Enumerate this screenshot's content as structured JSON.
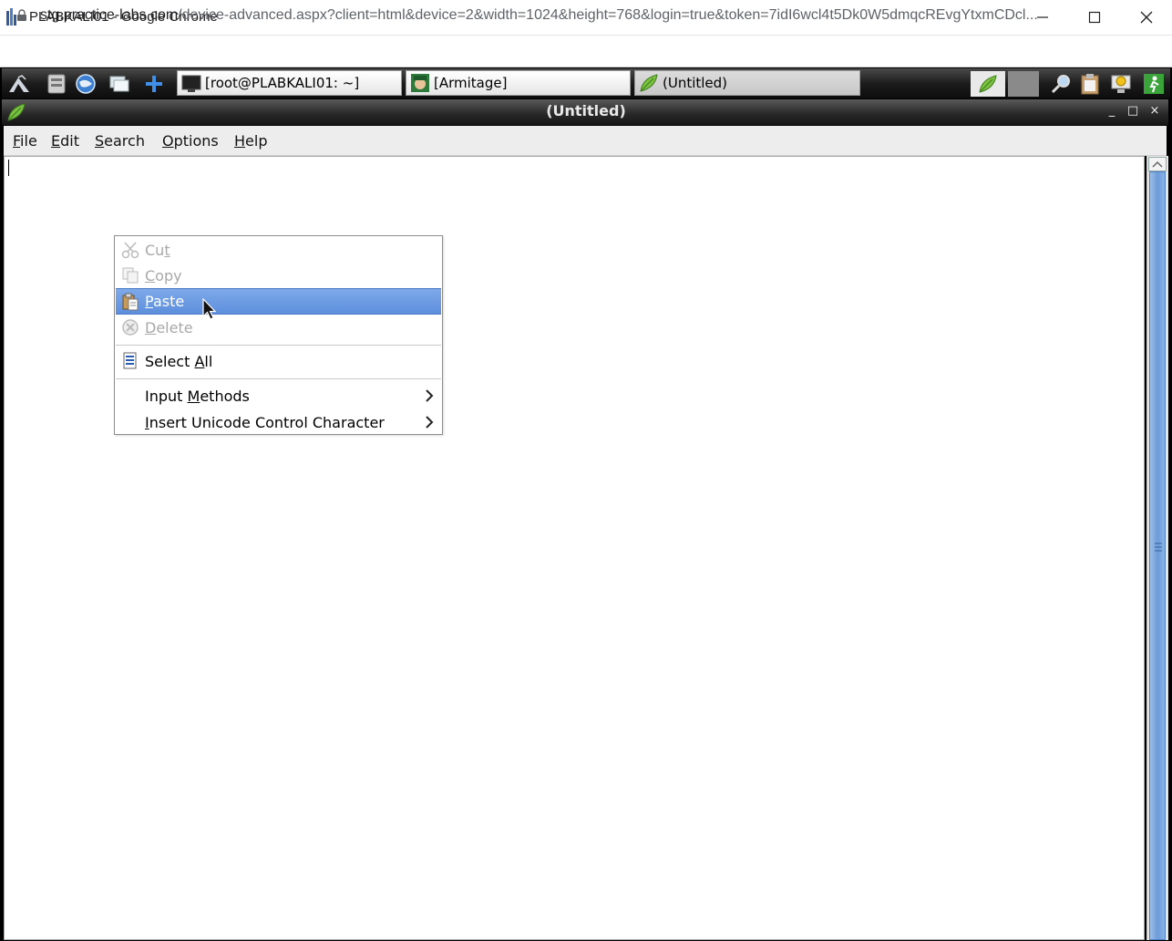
{
  "browser": {
    "title": "PLABKALI01 - Google Chrome",
    "url_host": "stg.practice-labs.com",
    "url_path": "/device-advanced.aspx?client=html&device=2&width=1024&height=768&login=true&token=7idI6wcl4t5Dk0W5dmqcREvgYtxmCDcl..."
  },
  "panel": {
    "icons": [
      "kali-menu-icon",
      "file-manager-icon",
      "browser-icon",
      "show-desktop-icon",
      "add-launcher-icon"
    ],
    "tasks": [
      {
        "label": "[root@PLABKALI01: ~]",
        "icon": "terminal-icon"
      },
      {
        "label": "[Armitage]",
        "icon": "armitage-icon"
      },
      {
        "label": "(Untitled)",
        "icon": "leafpad-icon"
      }
    ],
    "tray": [
      "leafpad-tray-icon",
      "search-tray-icon",
      "clipboard-icon",
      "update-notifier-icon",
      "logout-icon"
    ]
  },
  "window": {
    "title": "(Untitled)",
    "controls": {
      "minimize": "_",
      "maximize": "□",
      "close": "×"
    }
  },
  "menubar": {
    "items": [
      {
        "pre": "",
        "u": "F",
        "post": "ile"
      },
      {
        "pre": "",
        "u": "E",
        "post": "dit"
      },
      {
        "pre": "",
        "u": "S",
        "post": "earch"
      },
      {
        "pre": "",
        "u": "O",
        "post": "ptions"
      },
      {
        "pre": "",
        "u": "H",
        "post": "elp"
      }
    ]
  },
  "context_menu": {
    "cut": {
      "pre": "Cu",
      "u": "t",
      "post": ""
    },
    "copy": {
      "pre": "",
      "u": "C",
      "post": "opy"
    },
    "paste": {
      "pre": "",
      "u": "P",
      "post": "aste"
    },
    "delete": {
      "pre": "",
      "u": "D",
      "post": "elete"
    },
    "select_all": {
      "pre": "Select ",
      "u": "A",
      "post": "ll"
    },
    "input_methods": {
      "pre": "Input ",
      "u": "M",
      "post": "ethods"
    },
    "insert_unicode": {
      "pre": "",
      "u": "I",
      "post": "nsert Unicode Control Character"
    }
  },
  "colors": {
    "menu_highlight": "#6b9be0",
    "scrollbar_thumb": "#7ea7e0"
  }
}
